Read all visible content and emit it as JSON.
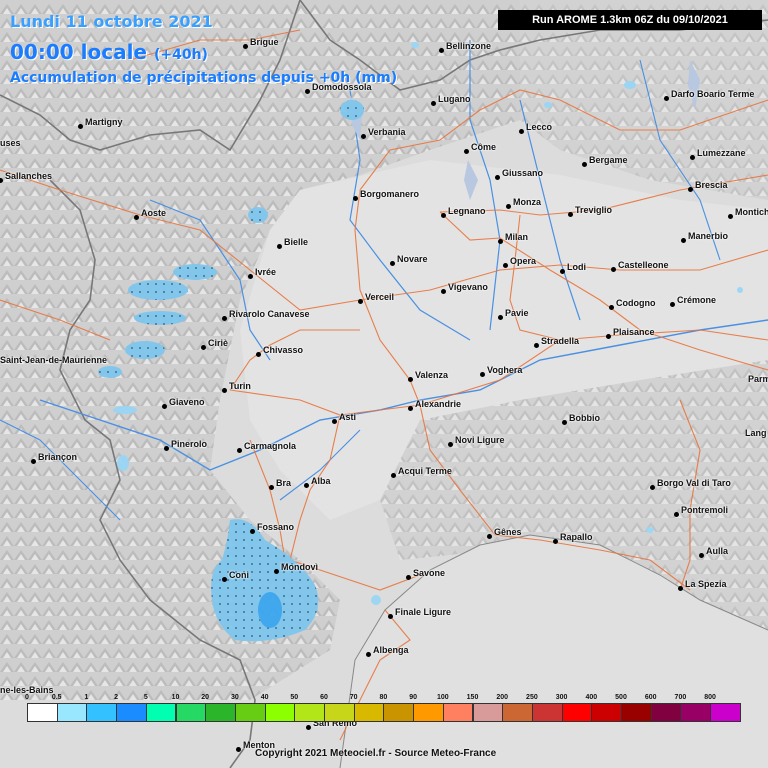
{
  "header": {
    "date": "Lundi 11 octobre 2021",
    "time": "00:00 locale",
    "offset": "(+40h)",
    "subtitle": "Accumulation de précipitations depuis +0h (mm)",
    "run": "Run AROME 1.3km 06Z du 09/10/2021"
  },
  "cities": [
    "Brigue",
    "Bellinzone",
    "Domodossola",
    "Lugano",
    "Martigny",
    "Verbania",
    "Lecco",
    "Darfo Boario Terme",
    "Côme",
    "Bergame",
    "Lumezzane",
    "Giussano",
    "Sallanches",
    "Borgomanero",
    "Brescia",
    "Aoste",
    "Legnano",
    "Monza",
    "Treviglio",
    "Montichiari",
    "Bielle",
    "Milan",
    "Manerbio",
    "Ivrée",
    "Novare",
    "Opera",
    "Lodi",
    "Castelleone",
    "Vigevano",
    "Verceil",
    "Codogno",
    "Crémone",
    "Rivarolo Canavese",
    "Pavie",
    "Plaisance",
    "Ciriè",
    "Chivasso",
    "Stradella",
    "Voghera",
    "Valenza",
    "Turin",
    "Giaveno",
    "Alexandrie",
    "Asti",
    "Bobbio",
    "Pinerolo",
    "Carmagnola",
    "Novi Ligure",
    "Briançon",
    "Bra",
    "Alba",
    "Acqui Terme",
    "Borgo Val di Taro",
    "Pontremoli",
    "Fossano",
    "Gênes",
    "Rapallo",
    "Aulla",
    "Coni",
    "Mondovì",
    "Savone",
    "La Spezia",
    "Finale Ligure",
    "Albenga",
    "Menton",
    "San Remo"
  ],
  "edge_labels": [
    "uses",
    "Saint-Jean-de-Maurienne",
    "Parm",
    "Lang",
    "ne-les-Bains"
  ],
  "legend": {
    "labels": [
      "0",
      "0.5",
      "1",
      "2",
      "5",
      "10",
      "20",
      "30",
      "40",
      "50",
      "60",
      "70",
      "80",
      "90",
      "100",
      "150",
      "200",
      "250",
      "300",
      "400",
      "500",
      "600",
      "700",
      "800"
    ],
    "colors": [
      "#ffffff",
      "#99e6ff",
      "#33c2ff",
      "#1a8cff",
      "#00ffb0",
      "#26d965",
      "#2ab52a",
      "#66cc14",
      "#8cff00",
      "#b3e619",
      "#c8d61a",
      "#d9b800",
      "#c99400",
      "#ff9900",
      "#ff8060",
      "#d99a9a",
      "#cc6633",
      "#cc3333",
      "#ff0000",
      "#cc0000",
      "#990000",
      "#800040",
      "#990066",
      "#cc00cc"
    ]
  },
  "copyright": "Copyright 2021 Meteociel.fr - Source Meteo-France"
}
